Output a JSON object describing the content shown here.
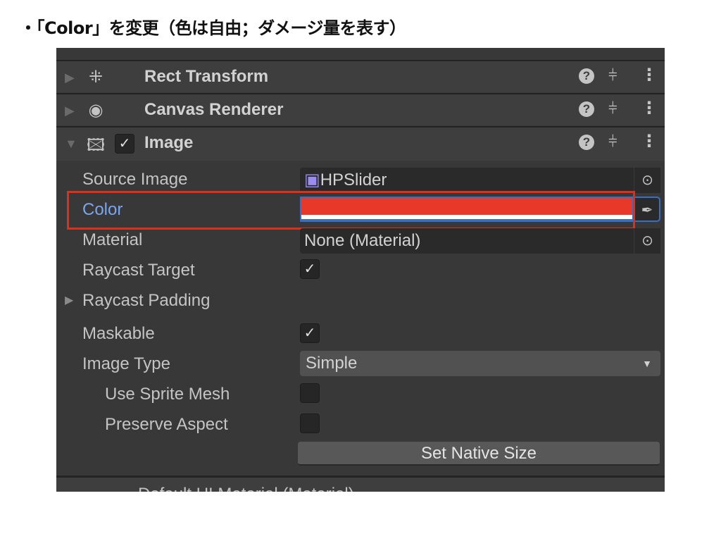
{
  "heading": "・「Color」を変更（色は自由；ダメージ量を表す）",
  "components": [
    {
      "name": "Rect Transform",
      "icon": "rect-transform-icon",
      "expanded": false
    },
    {
      "name": "Canvas Renderer",
      "icon": "eye-icon",
      "expanded": false
    },
    {
      "name": "Image",
      "icon": "image-icon",
      "expanded": true,
      "enabled": true
    }
  ],
  "properties": {
    "source_image": {
      "label": "Source Image",
      "value": "HPSlider"
    },
    "color": {
      "label": "Color",
      "value": "#e8382a"
    },
    "material": {
      "label": "Material",
      "value": "None (Material)"
    },
    "raycast_target": {
      "label": "Raycast Target",
      "checked": true
    },
    "raycast_padding": {
      "label": "Raycast Padding"
    },
    "maskable": {
      "label": "Maskable",
      "checked": true
    },
    "image_type": {
      "label": "Image Type",
      "value": "Simple"
    },
    "use_sprite_mesh": {
      "label": "Use Sprite Mesh",
      "checked": false
    },
    "preserve_aspect": {
      "label": "Preserve Aspect",
      "checked": false
    }
  },
  "set_native_size": "Set Native Size",
  "next_component": "Default UI Material (Material)",
  "annotation_color": "#d8321f"
}
